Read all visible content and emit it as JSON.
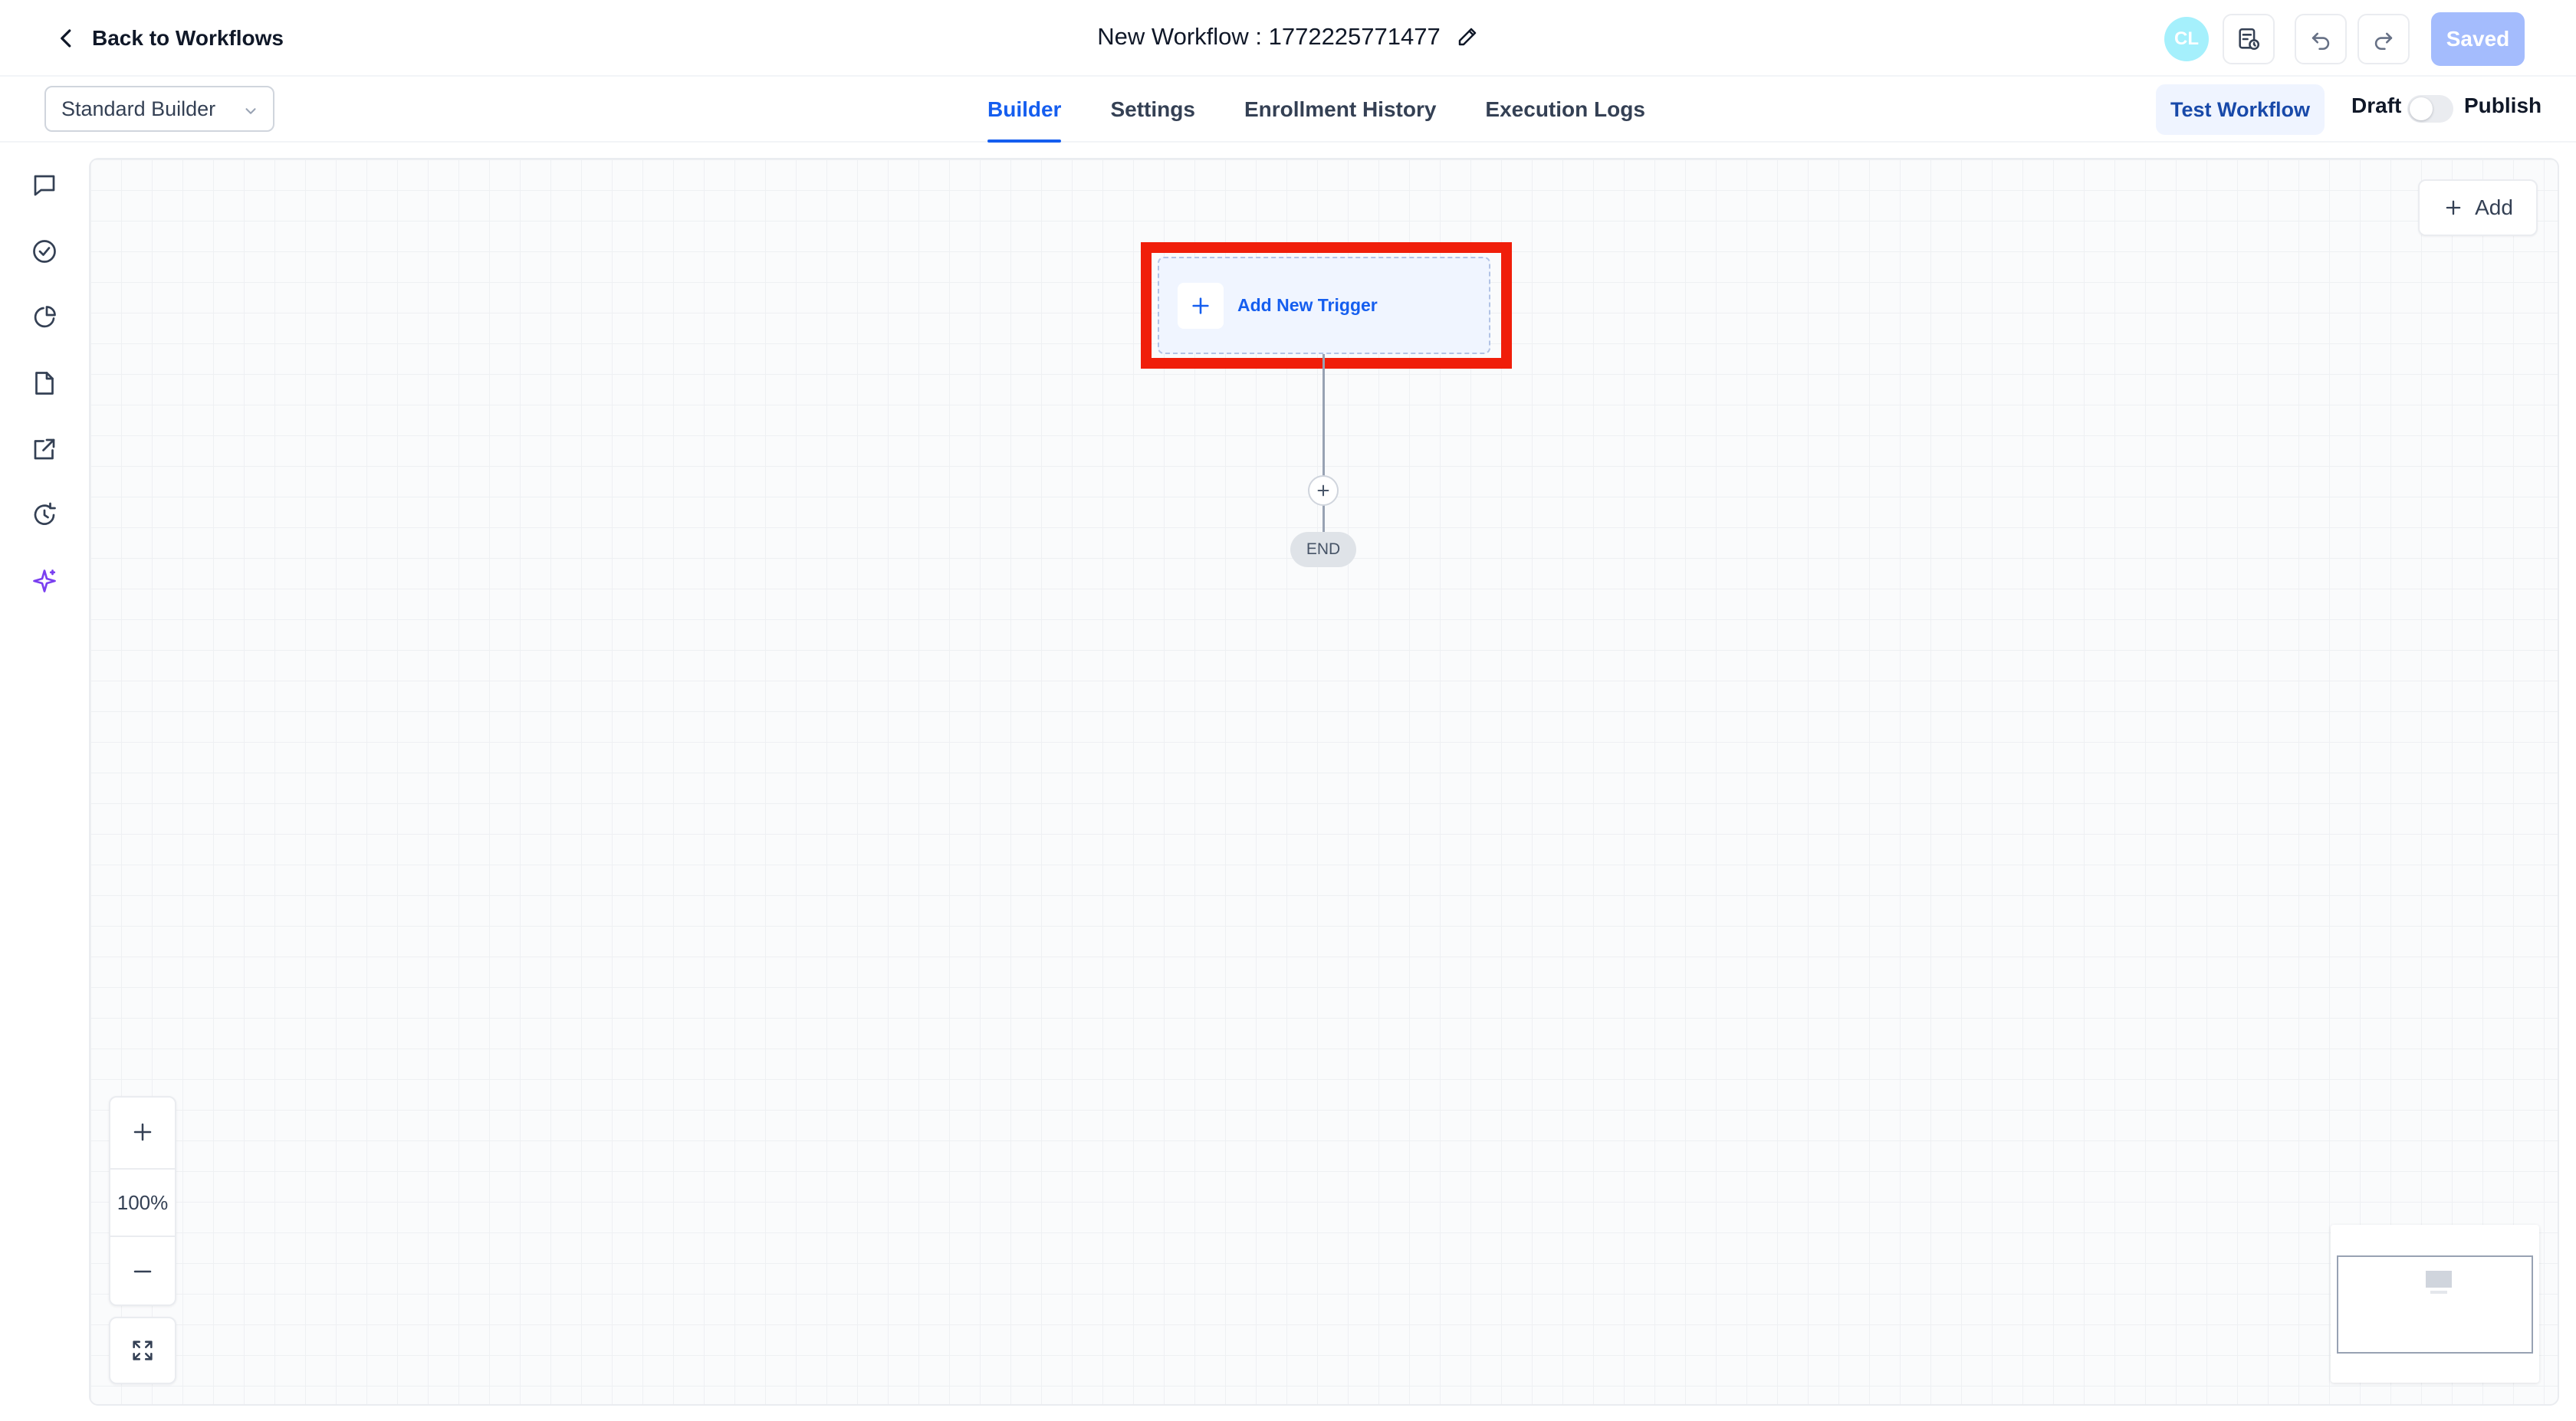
{
  "header": {
    "back_label": "Back to Workflows",
    "workflow_title": "New Workflow : 1772225771477",
    "avatar_initials": "CL",
    "saved_label": "Saved"
  },
  "subbar": {
    "builder_select_value": "Standard Builder",
    "tabs": [
      {
        "label": "Builder",
        "active": true
      },
      {
        "label": "Settings",
        "active": false
      },
      {
        "label": "Enrollment History",
        "active": false
      },
      {
        "label": "Execution Logs",
        "active": false
      }
    ],
    "test_workflow_label": "Test Workflow",
    "draft_label": "Draft",
    "publish_label": "Publish",
    "publish_toggle_on": false
  },
  "left_rail": {
    "icons": [
      "chat-icon",
      "check-circle-icon",
      "pie-chart-icon",
      "document-icon",
      "external-link-icon",
      "history-icon",
      "sparkle-icon"
    ]
  },
  "canvas": {
    "add_label": "Add",
    "trigger_label": "Add New Trigger",
    "end_label": "END",
    "zoom_level": "100%"
  },
  "colors": {
    "accent": "#155eef",
    "highlight": "#f01e0a",
    "saved_bg": "#a4bcfd",
    "avatar_bg": "#a5f0fc",
    "sparkle": "#7a3ff0"
  }
}
